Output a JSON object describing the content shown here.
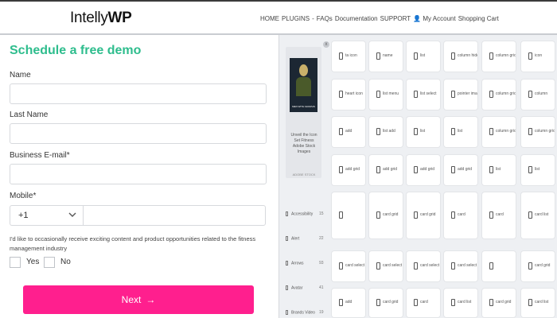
{
  "header": {
    "logo_regular": "Intelly",
    "logo_bold": "WP",
    "nav": [
      "HOME",
      "PLUGINS",
      "-",
      "FAQs",
      "Documentation",
      "SUPPORT",
      "👤 My Account",
      "Shopping Cart"
    ]
  },
  "form": {
    "title": "Schedule a free demo",
    "name_label": "Name",
    "last_name_label": "Last Name",
    "email_label": "Business E-mail*",
    "mobile_label": "Mobile*",
    "country_code": "+1",
    "consent_text": "I'd like to occasionally receive exciting content and product opportunities related to the fitness management industry",
    "yes_label": "Yes",
    "no_label": "No",
    "next_label": "Next",
    "next_arrow": "→"
  },
  "sidebar_ad": {
    "image_caption": "MEN WITH GRAPHS",
    "text": "Unveil the Icon Set Fitness Adobe Stock Images",
    "sub": "ADOBE STOCK",
    "close": "x"
  },
  "sidebar_list": [
    {
      "label": "Accessibility",
      "count": "15"
    },
    {
      "label": "Alert",
      "count": "22"
    },
    {
      "label": "Arrows",
      "count": "93"
    },
    {
      "label": "Avatar",
      "count": "41"
    },
    {
      "label": "Brands Video",
      "count": "19"
    }
  ],
  "icon_tiles": [
    [
      "ta icon",
      "name",
      "list",
      "column hide",
      "column grid",
      "icon"
    ],
    [
      "heart icon",
      "list menu",
      "list select",
      "pointer image",
      "column grid",
      "column"
    ],
    [
      "add",
      "list add",
      "list",
      "list",
      "column grid",
      "column grid"
    ],
    [
      "add grid",
      "add grid",
      "add grid",
      "add grid",
      "list",
      "list"
    ],
    [
      "",
      "card grid",
      "card grid",
      "card",
      "card",
      "card list"
    ],
    [
      "card select",
      "card select",
      "card select",
      "card select",
      "",
      "card grid"
    ],
    [
      "add",
      "card grid",
      "card",
      "card list",
      "card grid",
      "card list"
    ]
  ]
}
